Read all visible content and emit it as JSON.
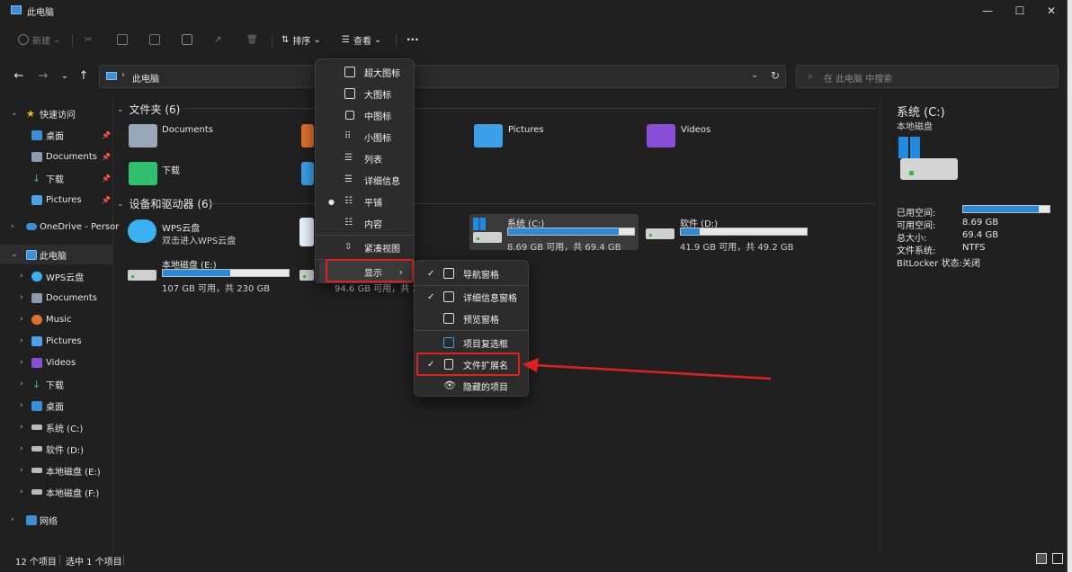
{
  "window": {
    "title": "此电脑"
  },
  "toolbar": {
    "new_label": "新建",
    "sort_label": "排序",
    "view_label": "查看",
    "more_label": "···"
  },
  "address": {
    "path": "此电脑",
    "search_placeholder": "在 此电脑 中搜索"
  },
  "nav": {
    "quick_access": "快速访问",
    "items": [
      {
        "label": "桌面"
      },
      {
        "label": "Documents"
      },
      {
        "label": "下载"
      },
      {
        "label": "Pictures"
      },
      {
        "label": "OneDrive - Persor"
      },
      {
        "label": "此电脑"
      },
      {
        "label": "WPS云盘"
      },
      {
        "label": "Documents"
      },
      {
        "label": "Music"
      },
      {
        "label": "Pictures"
      },
      {
        "label": "Videos"
      },
      {
        "label": "下载"
      },
      {
        "label": "桌面"
      },
      {
        "label": "系统 (C:)"
      },
      {
        "label": "软件 (D:)"
      },
      {
        "label": "本地磁盘 (E:)"
      },
      {
        "label": "本地磁盘 (F:)"
      },
      {
        "label": "网络"
      }
    ]
  },
  "content": {
    "folders_header": "文件夹 (6)",
    "folders": [
      "Documents",
      "Pictures",
      "Videos",
      "下载"
    ],
    "devices_header": "设备和驱动器 (6)",
    "wps": {
      "name": "WPS云盘",
      "desc": "双击进入WPS云盘"
    },
    "drives": [
      {
        "name": "系统 (C:)",
        "info": "8.69 GB 可用，共 69.4 GB",
        "used": 0.875
      },
      {
        "name": "软件 (D:)",
        "info": "41.9 GB 可用，共 49.2 GB",
        "used": 0.148
      },
      {
        "name": "本地磁盘 (E:)",
        "info": "107 GB 可用，共 230 GB",
        "used": 0.535
      },
      {
        "name": "",
        "info": "94.6 GB 可用，共 23",
        "used": 0.6
      }
    ]
  },
  "view_menu": {
    "items": [
      "超大图标",
      "大图标",
      "中图标",
      "小图标",
      "列表",
      "详细信息",
      "平铺",
      "内容",
      "紧凑视图",
      "显示"
    ]
  },
  "show_menu": {
    "items": [
      "导航窗格",
      "详细信息窗格",
      "预览窗格",
      "项目复选框",
      "文件扩展名",
      "隐藏的项目"
    ]
  },
  "details": {
    "title": "系统 (C:)",
    "subtitle": "本地磁盘",
    "rows": [
      {
        "k": "已用空间:",
        "v": ""
      },
      {
        "k": "可用空间:",
        "v": "8.69 GB"
      },
      {
        "k": "总大小:",
        "v": "69.4 GB"
      },
      {
        "k": "文件系统:",
        "v": "NTFS"
      },
      {
        "k": "BitLocker 状态:",
        "v": "关闭"
      }
    ],
    "used_fraction": 0.875
  },
  "status": {
    "count": "12 个项目",
    "selected": "选中 1 个项目"
  },
  "colors": {
    "accent": "#2a8ad8",
    "highlight": "#e02020"
  }
}
